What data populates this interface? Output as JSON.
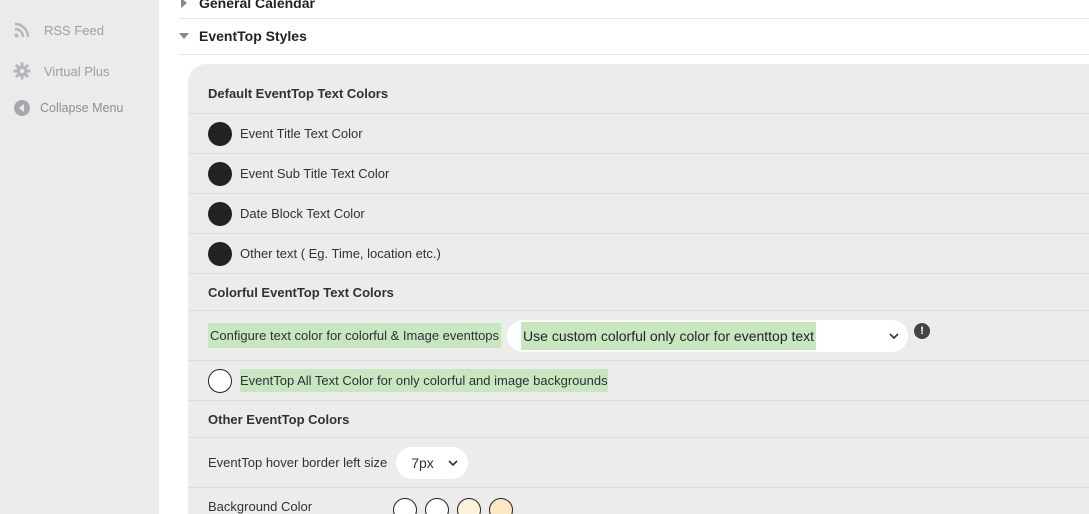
{
  "sidebar": {
    "items": [
      {
        "label": "RSS Feed",
        "icon": "rss-icon"
      },
      {
        "label": "Virtual Plus",
        "icon": "gear-icon"
      },
      {
        "label": "Collapse Menu",
        "icon": "collapse-arrow-icon"
      }
    ]
  },
  "sections": {
    "general_calendar": "General Calendar",
    "eventtop_styles": "EventTop Styles"
  },
  "panel": {
    "default_heading": "Default EventTop Text Colors",
    "color_rows": [
      {
        "label": "Event Title Text Color",
        "color": "#222222"
      },
      {
        "label": "Event Sub Title Text Color",
        "color": "#222222"
      },
      {
        "label": "Date Block Text Color",
        "color": "#222222"
      },
      {
        "label": "Other text ( Eg. Time, location etc.)",
        "color": "#222222"
      }
    ],
    "colorful_heading": "Colorful EventTop Text Colors",
    "configure_label": "Configure text color for colorful & Image eventtops",
    "configure_value": "Use custom colorful only color for eventtop text",
    "info_icon": "!",
    "all_text_label": "EventTop All Text Color for only colorful and image backgrounds",
    "all_text_color": "#ffffff",
    "other_heading": "Other EventTop Colors",
    "hover_border_label": "EventTop hover border left size",
    "hover_border_value": "7px",
    "background_label": "Background Color",
    "background_options": [
      "#ffffff",
      "#ffffff",
      "#fdf3dc",
      "#fce8c4"
    ]
  },
  "colors": {
    "highlight": "#c8e6c0",
    "panel_bg": "#ececec",
    "sidebar_bg": "#ebebeb"
  }
}
